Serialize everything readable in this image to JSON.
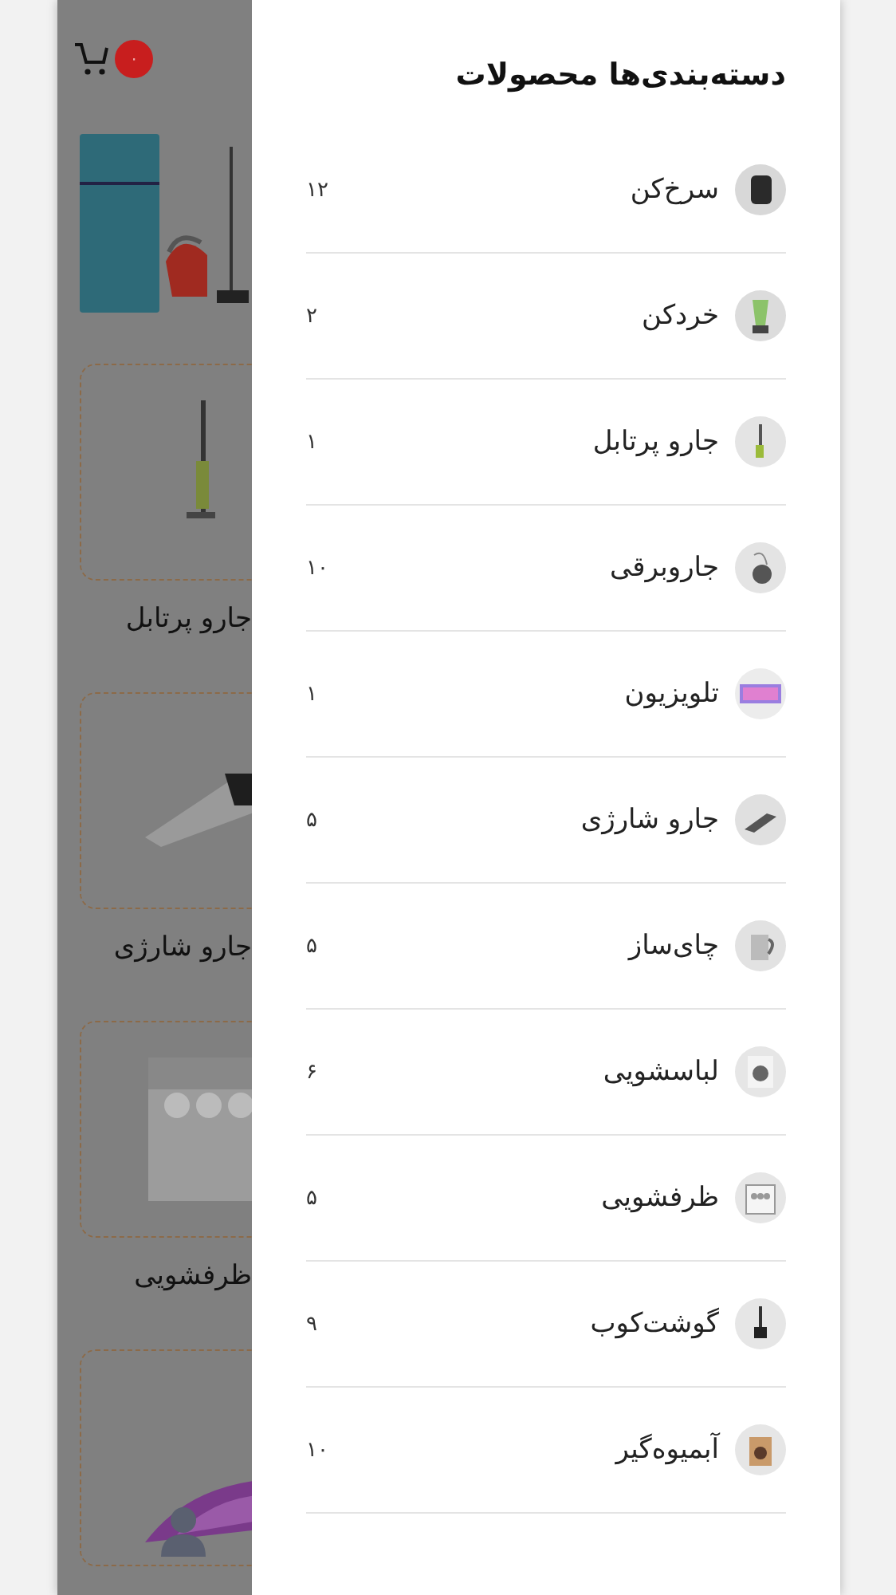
{
  "background_page": {
    "cart_badge": "۰",
    "products": [
      {
        "name": "جارو پرتابل"
      },
      {
        "name": "جارو شارژی"
      },
      {
        "name": "ظرفشویی"
      }
    ]
  },
  "drawer": {
    "title": "دسته‌بندی‌ها محصولات",
    "categories": [
      {
        "name": "سرخ‌کن",
        "count": "۱۲"
      },
      {
        "name": "خردکن",
        "count": "۲"
      },
      {
        "name": "جارو پرتابل",
        "count": "۱"
      },
      {
        "name": "جاروبرقی",
        "count": "۱۰"
      },
      {
        "name": "تلویزیون",
        "count": "۱"
      },
      {
        "name": "جارو شارژی",
        "count": "۵"
      },
      {
        "name": "چای‌ساز",
        "count": "۵"
      },
      {
        "name": "لباسشویی",
        "count": "۶"
      },
      {
        "name": "ظرفشویی",
        "count": "۵"
      },
      {
        "name": "گوشت‌کوب",
        "count": "۹"
      },
      {
        "name": "آبمیوه‌گیر",
        "count": "۱۰"
      }
    ]
  }
}
